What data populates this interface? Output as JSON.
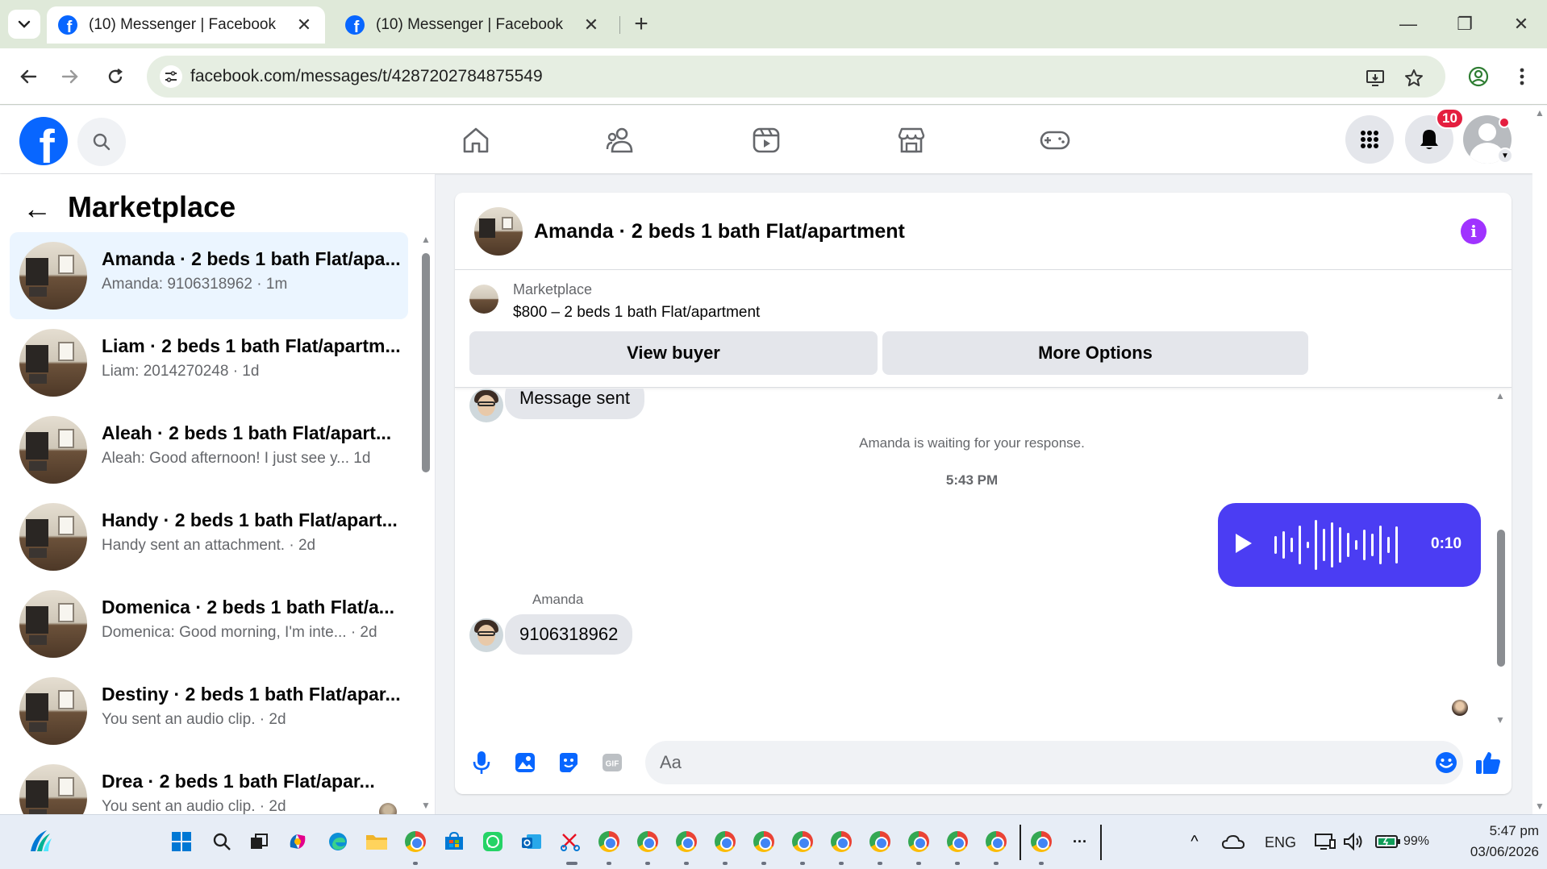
{
  "browser": {
    "tabs": [
      {
        "title": "(10) Messenger | Facebook",
        "active": true
      },
      {
        "title": "(10) Messenger | Facebook",
        "active": false
      }
    ],
    "new_tab_symbol": "+",
    "close_symbol": "✕",
    "url": "facebook.com/messages/t/4287202784875549",
    "window_controls": {
      "minimize": "—",
      "maximize": "❐",
      "close": "✕"
    }
  },
  "fb_header": {
    "logo_letter": "f",
    "notification_count": "10",
    "nav_icons": [
      "home-icon",
      "friends-icon",
      "video-icon",
      "marketplace-icon",
      "gaming-icon"
    ]
  },
  "sidebar": {
    "title": "Marketplace",
    "back_symbol": "←",
    "conversations": [
      {
        "name": "Amanda · 2 beds 1 bath Flat/apa...",
        "preview": "Amanda: 9106318962 · 1m",
        "selected": true
      },
      {
        "name": "Liam · 2 beds 1 bath Flat/apartm...",
        "preview": "Liam: 2014270248 · 1d",
        "selected": false
      },
      {
        "name": "Aleah · 2 beds 1 bath Flat/apart...",
        "preview": "Aleah: Good afternoon! I just see y...   1d",
        "selected": false
      },
      {
        "name": "Handy · 2 beds 1 bath Flat/apart...",
        "preview": "Handy sent an attachment. · 2d",
        "selected": false
      },
      {
        "name": "Domenica · 2 beds 1 bath Flat/a...",
        "preview": "Domenica: Good morning, I'm inte...  · 2d",
        "selected": false
      },
      {
        "name": "Destiny · 2 beds 1 bath Flat/apar...",
        "preview": "You sent an audio clip. · 2d",
        "selected": false
      },
      {
        "name": "Drea · 2 beds 1 bath Flat/apar...",
        "preview": "You sent an audio clip. · 2d",
        "selected": false
      }
    ]
  },
  "chat": {
    "title": "Amanda · 2 beds 1 bath Flat/apartment",
    "info_symbol": "i",
    "listing": {
      "label": "Marketplace",
      "price_title": "$800 – 2 beds 1 bath Flat/apartment",
      "view_buyer": "View buyer",
      "more_options": "More Options"
    },
    "messages": {
      "first_bubble": "Message sent",
      "waiting_notice": "Amanda is waiting for your response.",
      "timestamp": "5:43 PM",
      "audio_duration": "0:10",
      "sender_name": "Amanda",
      "last_bubble": "9106318962"
    },
    "composer": {
      "placeholder": "Aa",
      "gif_label": "GIF"
    }
  },
  "taskbar": {
    "language": "ENG",
    "battery": "99%",
    "time": "5:47 pm",
    "date": "03/06/2026",
    "more_symbol": "···",
    "chevron_symbol": "^"
  }
}
